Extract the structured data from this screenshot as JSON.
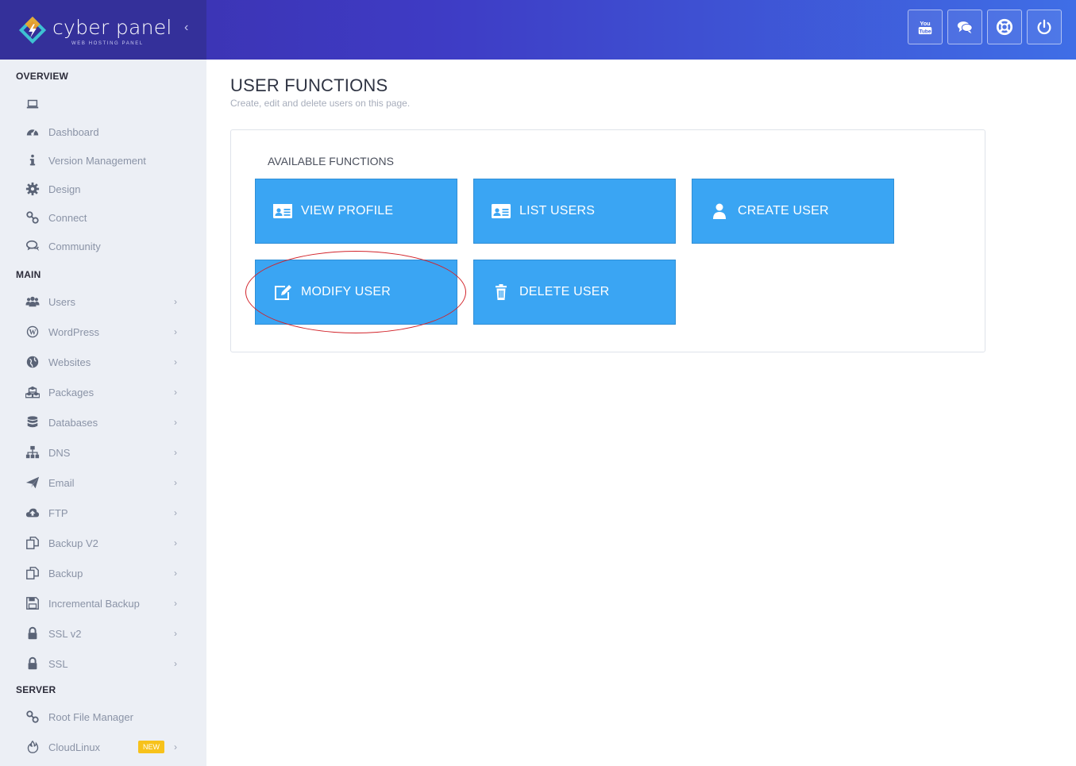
{
  "brand": {
    "name": "cyber panel",
    "tagline": "WEB HOSTING PANEL",
    "collapse_icon": "chevron-left-icon"
  },
  "top_actions": [
    {
      "name": "youtube-button",
      "icon": "youtube-icon"
    },
    {
      "name": "chat-button",
      "icon": "chat-icon"
    },
    {
      "name": "support-button",
      "icon": "lifebuoy-icon"
    },
    {
      "name": "power-button",
      "icon": "power-icon"
    }
  ],
  "sidebar": {
    "sections": {
      "overview": "OVERVIEW",
      "main": "MAIN",
      "server": "SERVER"
    },
    "overview_items": [
      {
        "label": "",
        "icon": "laptop-icon"
      },
      {
        "label": "Dashboard",
        "icon": "dashboard-icon"
      },
      {
        "label": "Version Management",
        "icon": "info-icon"
      },
      {
        "label": "Design",
        "icon": "gear-icon"
      },
      {
        "label": "Connect",
        "icon": "link-icon"
      },
      {
        "label": "Community",
        "icon": "comments-icon"
      }
    ],
    "main_items": [
      {
        "label": "Users",
        "icon": "users-icon"
      },
      {
        "label": "WordPress",
        "icon": "wordpress-icon"
      },
      {
        "label": "Websites",
        "icon": "globe-icon"
      },
      {
        "label": "Packages",
        "icon": "cubes-icon"
      },
      {
        "label": "Databases",
        "icon": "database-icon"
      },
      {
        "label": "DNS",
        "icon": "sitemap-icon"
      },
      {
        "label": "Email",
        "icon": "paper-plane-icon"
      },
      {
        "label": "FTP",
        "icon": "cloud-upload-icon"
      },
      {
        "label": "Backup V2",
        "icon": "copy-icon"
      },
      {
        "label": "Backup",
        "icon": "copy-icon"
      },
      {
        "label": "Incremental Backup",
        "icon": "floppy-icon"
      },
      {
        "label": "SSL v2",
        "icon": "lock-icon"
      },
      {
        "label": "SSL",
        "icon": "lock-icon"
      }
    ],
    "server_items": [
      {
        "label": "Root File Manager",
        "icon": "link-icon"
      },
      {
        "label": "CloudLinux",
        "icon": "fire-icon",
        "badge": "NEW"
      }
    ],
    "chevron": "›"
  },
  "main": {
    "title": "USER FUNCTIONS",
    "subtitle": "Create, edit and delete users on this page.",
    "panel_title": "AVAILABLE FUNCTIONS",
    "functions": [
      {
        "label": "VIEW PROFILE",
        "icon": "id-card-icon"
      },
      {
        "label": "LIST USERS",
        "icon": "id-card-icon"
      },
      {
        "label": "CREATE USER",
        "icon": "user-icon"
      },
      {
        "label": "MODIFY USER",
        "icon": "edit-icon"
      },
      {
        "label": "DELETE USER",
        "icon": "trash-icon"
      }
    ]
  },
  "colors": {
    "header_start": "#3b2fa8",
    "header_end": "#3f6ee6",
    "button_blue": "#3aa5f3",
    "sidebar_bg": "#eceff5",
    "highlight_red": "#d2232a",
    "badge_yellow": "#f7c21b"
  }
}
